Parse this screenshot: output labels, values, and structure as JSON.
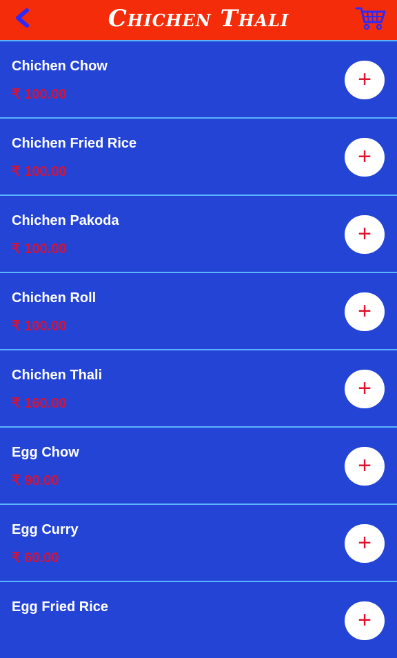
{
  "header": {
    "title": "Chichen Thali",
    "back_icon": "chevron-left-icon",
    "cart_icon": "cart-icon"
  },
  "colors": {
    "header_bg": "#f52c09",
    "list_bg": "#2444d6",
    "divider": "#5ab4ff",
    "price": "#d0143c",
    "plus": "#e0122c",
    "back_icon": "#2a2aff"
  },
  "items": [
    {
      "name": "Chichen Chow",
      "price": "₹ 100.00",
      "add_icon": "plus-icon",
      "add_label": "+"
    },
    {
      "name": "Chichen Fried Rice",
      "price": "₹ 100.00",
      "add_icon": "plus-icon",
      "add_label": "+"
    },
    {
      "name": "Chichen Pakoda",
      "price": "₹ 100.00",
      "add_icon": "plus-icon",
      "add_label": "+"
    },
    {
      "name": "Chichen Roll",
      "price": "₹ 100.00",
      "add_icon": "plus-icon",
      "add_label": "+"
    },
    {
      "name": "Chichen Thali",
      "price": "₹ 160.00",
      "add_icon": "plus-icon",
      "add_label": "+"
    },
    {
      "name": "Egg Chow",
      "price": "₹ 90.00",
      "add_icon": "plus-icon",
      "add_label": "+"
    },
    {
      "name": "Egg Curry",
      "price": "₹ 60.00",
      "add_icon": "plus-icon",
      "add_label": "+"
    },
    {
      "name": "Egg Fried Rice",
      "price": "",
      "add_icon": "plus-icon",
      "add_label": "+"
    }
  ]
}
